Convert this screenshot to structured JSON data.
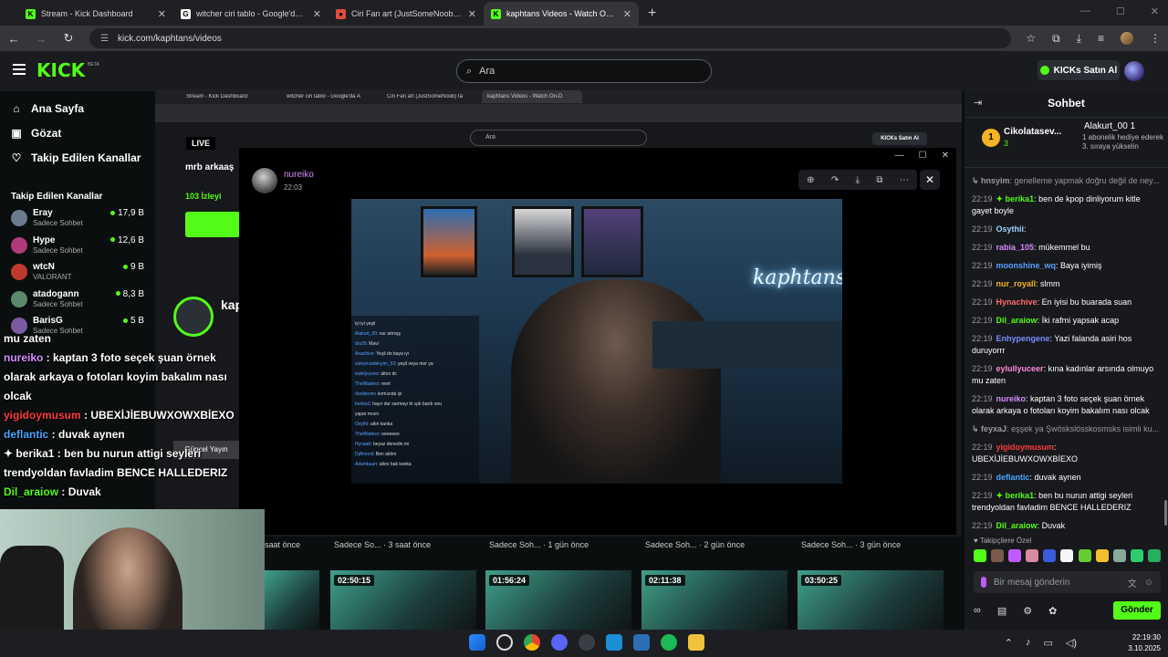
{
  "browser": {
    "tabs": [
      {
        "title": "Stream - Kick Dashboard",
        "fav_color": "#53fc18",
        "fav_glyph": "K"
      },
      {
        "title": "witcher ciri tablo - Google'da Ara",
        "fav_color": "#ffffff",
        "fav_glyph": "G"
      },
      {
        "title": "Ciri Fan art (JustSomeNoob) tar",
        "fav_color": "#e04b3a",
        "fav_glyph": "●"
      },
      {
        "title": "kaphtans Videos - Watch On-D",
        "fav_color": "#53fc18",
        "fav_glyph": "K"
      }
    ],
    "url": "kick.com/kaphtans/videos"
  },
  "kick": {
    "logo": "KICK",
    "beta": "BETA",
    "search_placeholder": "Ara",
    "kicks_button": "KICKs Satın Al"
  },
  "sidebar": {
    "nav": [
      {
        "label": "Ana Sayfa",
        "icon": "home-icon",
        "glyph": "⌂"
      },
      {
        "label": "Gözat",
        "icon": "browse-icon",
        "glyph": "▣"
      },
      {
        "label": "Takip Edilen Kanallar",
        "icon": "heart-icon",
        "glyph": "♡"
      }
    ],
    "followed_title": "Takip Edilen Kanallar",
    "channels": [
      {
        "name": "Eray",
        "sub": "Sadece Sohbet",
        "viewers": "17,9 B",
        "color": "#6a7b8c"
      },
      {
        "name": "Hype",
        "sub": "Sadece Sohbet",
        "viewers": "12,6 B",
        "color": "#b03a7a"
      },
      {
        "name": "wtcN",
        "sub": "VALORANT",
        "viewers": "9 B",
        "color": "#c0392b"
      },
      {
        "name": "atadogann",
        "sub": "Sadece Sohbet",
        "viewers": "8,3 B",
        "color": "#5a8a6a"
      },
      {
        "name": "BarisG",
        "sub": "Sadece Sohbet",
        "viewers": "5 B",
        "color": "#7a5aa0"
      }
    ]
  },
  "embed": {
    "tabs": [
      "Stream - Kick Dashboard",
      "witcher ciri tablo - Google'da A",
      "Ciri Fan art (JustSomeNoob) ta",
      "kaphtans Videos - Watch On-D"
    ],
    "search": "Ara",
    "kicks": "KICKs Satın Al",
    "live": "LIVE",
    "title": "mrb arkaaş",
    "viewers": "103 İzleyi",
    "channel": "kap",
    "update": "Güncel Yayın"
  },
  "viewer": {
    "poster": "nureiko",
    "time": "22:03",
    "neon": "kaphtans",
    "overlay_chat": [
      {
        "u": "",
        "t": "iyi iyi yeşil"
      },
      {
        "u": "Alakurt_00",
        "t": "nur atmışş"
      },
      {
        "u": "drs26",
        "t": "Mavi"
      },
      {
        "u": "Anachive",
        "t": "Yeşil de baya iyi"
      },
      {
        "u": "suleymanbinyim_53",
        "t": "yeşil veya mor ya"
      },
      {
        "u": "eulelyuceer",
        "t": "altını dc"
      },
      {
        "u": "TheWadexx",
        "t": "evet"
      },
      {
        "u": "donibeom",
        "t": "kırmızıda iyi"
      },
      {
        "u": "berika1",
        "t": "hayır dur sarmayı bi ışık bardı onu"
      },
      {
        "u": "",
        "t": "yapar mısın"
      },
      {
        "u": "Osythi",
        "t": "altın kanka"
      },
      {
        "u": "TheWadexx",
        "t": "eeeeeee"
      },
      {
        "u": "Hynaab",
        "t": "beyaz denedin mi"
      },
      {
        "u": "DjAhmoil",
        "t": "Ben aldım"
      },
      {
        "u": "Adamkaan",
        "t": "altını bak kanka"
      }
    ]
  },
  "stream_overlay_chat": [
    {
      "name": "",
      "text": "mu zaten",
      "color": "#ffffff"
    },
    {
      "name": "nureiko",
      "text": " : kaptan 3 foto seçek şuan örnek",
      "color": "#d68cff"
    },
    {
      "name": "",
      "text": "olarak arkaya o fotoları koyim bakalım nası",
      "color": "#ffffff"
    },
    {
      "name": "",
      "text": "olcak",
      "color": "#ffffff"
    },
    {
      "name": "yigidoymusum",
      "text": " : UBEXİJİEBUWXOWXBİEXO",
      "color": "#ff3b3b"
    },
    {
      "name": "deflantic",
      "text": " : duvak aynen",
      "color": "#4aa3ff"
    },
    {
      "name": "✦ berika1",
      "text": " : ben bu nurun attigi seyleri",
      "color": "#ffffff"
    },
    {
      "name": "",
      "text": "trendyoldan favladim BENCE HALLEDERIZ",
      "color": "#ffffff"
    },
    {
      "name": "Dil_araiow",
      "text": " : Duvak",
      "color": "#53fc18"
    }
  ],
  "videos": [
    {
      "meta": "saat önce",
      "duration": ""
    },
    {
      "meta": "Sadece So... · 3 saat önce",
      "duration": "02:50:15"
    },
    {
      "meta": "Sadece Soh... · 1 gün önce",
      "duration": "01:56:24"
    },
    {
      "meta": "Sadece Soh... · 2 gün önce",
      "duration": "02:11:38"
    },
    {
      "meta": "Sadece Soh... · 3 gün önce",
      "duration": "03:50:25"
    }
  ],
  "chat": {
    "title": "Sohbet",
    "pinned1_name": "Cikolatasev...",
    "pinned1_rank": "1",
    "pinned1_value": "3",
    "pinned2_name": "Alakurt_00  1",
    "pinned2_desc": "1 abonelik hediye ederek 3. sıraya yükselin",
    "messages": [
      {
        "time": "",
        "name": "↳ hnsyim",
        "text": ": genelleme yapmak doğru değil de ney...",
        "color": "#9a9a9a"
      },
      {
        "time": "22:19",
        "name": "✦ berika1",
        "text": ": ben de kpop dinliyorum kitle gayet boyle",
        "color": "#53fc18"
      },
      {
        "time": "22:19",
        "name": "Osythii",
        "text": ":",
        "color": "#9ad1ff"
      },
      {
        "time": "22:19",
        "name": "rabia_105",
        "text": ": mükemmel bu",
        "color": "#d68cff"
      },
      {
        "time": "22:19",
        "name": "moonshine_wq",
        "text": ": Baya iyimiş",
        "color": "#5aa0ff"
      },
      {
        "time": "22:19",
        "name": "nur_royall",
        "text": ": slmm",
        "color": "#f5b324"
      },
      {
        "time": "22:19",
        "name": "Hynachive",
        "text": ": En iyisi bu buarada suan",
        "color": "#ff6b6b"
      },
      {
        "time": "22:19",
        "name": "Dil_araiow",
        "text": ": İki rafmi yapsak acap",
        "color": "#53fc18"
      },
      {
        "time": "22:19",
        "name": "Enhypengene",
        "text": ": Yazi falanda asiri hos duruyorrr",
        "color": "#7b8cff"
      },
      {
        "time": "22:19",
        "name": "eylullyuceer",
        "text": ": kına kadınlar arsında olmuyo mu zaten",
        "color": "#ff8ad8"
      },
      {
        "time": "22:19",
        "name": "nureiko",
        "text": ": kaptan 3 foto seçek şuan örnek olarak arkaya o fotoları koyim bakalım nası olcak",
        "color": "#d68cff"
      },
      {
        "time": "",
        "name": "↳ feyxaJ",
        "text": ": eşşek ya Şwöskslösskosmsks isimli ku...",
        "color": "#9a9a9a"
      },
      {
        "time": "22:19",
        "name": "yigidoymusum",
        "text": ": UBEXİJİEBUWXOWXBİEXO",
        "color": "#ff3b3b"
      },
      {
        "time": "22:19",
        "name": "deflantic",
        "text": ": duvak aynen",
        "color": "#4aa3ff"
      },
      {
        "time": "22:19",
        "name": "✦ berika1",
        "text": ": ben bu nurun attigi seyleri trendyoldan favladim BENCE HALLEDERIZ",
        "color": "#53fc18"
      },
      {
        "time": "22:19",
        "name": "Dil_araiow",
        "text": ": Duvak",
        "color": "#53fc18"
      }
    ],
    "followers_only": "♥ Takipçilere Özel",
    "input_placeholder": "Bir mesaj gönderin",
    "send": "Gönder"
  },
  "taskbar": {
    "time": "22:19:30",
    "date": "3.10.2025"
  }
}
